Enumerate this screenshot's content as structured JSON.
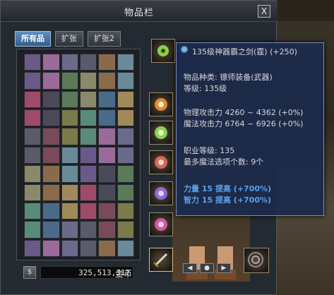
{
  "window": {
    "title": "物品栏",
    "close_label": "X"
  },
  "tabs": [
    {
      "label": "所有品",
      "active": true
    },
    {
      "label": "扩张",
      "active": false
    },
    {
      "label": "扩张2",
      "active": false
    }
  ],
  "gold": {
    "value": "325,513,312",
    "label": "金币"
  },
  "tooltip": {
    "title": "135级神器霸之剑(霆) (+250)",
    "category": "物品种类: 镖师装备(武器)",
    "level": "等级: 135级",
    "phys_attack": "物理攻击力 4260 ~ 4362 (+0%)",
    "magic_attack": "魔法攻击力 6764 ~ 6926 (+0%)",
    "job_level": "职业等级: 135",
    "magic_options": "最多魔法选项个数: 9个",
    "bonus_str": "力量 15 提高 (+700%)",
    "bonus_int": "智力 15 提高 (+700%)"
  },
  "colors": {
    "tooltip_bg": "#1c2a4a",
    "bonus_text": "#5aa0e8",
    "tab_active": "#335d8c"
  },
  "icons": [
    "close-icon",
    "gold-coin-icon",
    "sun-flower-icon",
    "sword-icon",
    "arrow-left-icon",
    "arrow-right-icon"
  ]
}
